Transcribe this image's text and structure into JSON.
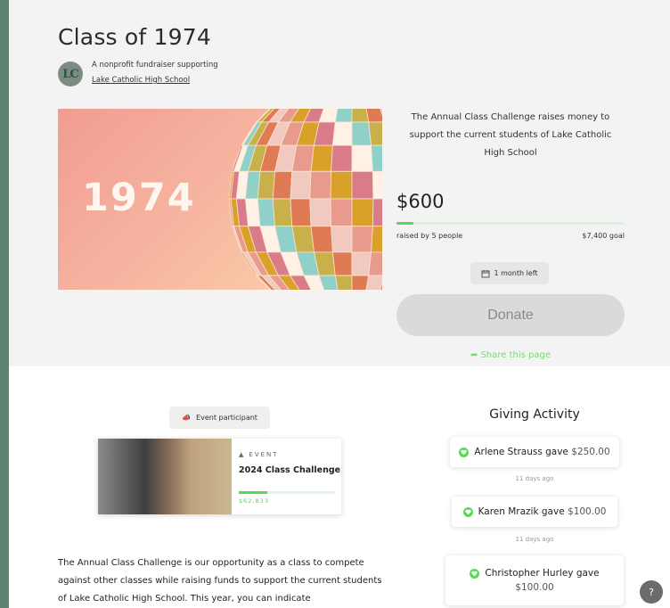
{
  "page": {
    "title": "Class of 1974"
  },
  "org": {
    "logo_text": "LC",
    "line1": "A nonprofit fundraiser supporting",
    "link": "Lake Catholic High School"
  },
  "hero": {
    "year_text": "1974"
  },
  "campaign": {
    "description": "The Annual Class Challenge raises money to support the current students of Lake Catholic High School",
    "raised_amount": "$600",
    "progress_fraction": 0.075,
    "raised_by": "raised by 5 people",
    "goal": "$7,400 goal",
    "time_left": "1 month left",
    "donate_label": "Donate",
    "share_label": "Share this page"
  },
  "participant": {
    "badge_label": "Event participant"
  },
  "event_card": {
    "kind": "EVENT",
    "title": "2024 Class Challenge",
    "amount": "$62,833",
    "progress_fraction": 0.3
  },
  "body": {
    "text": "The Annual Class Challenge is our opportunity as a class to compete against other classes while raising funds to support the current students of Lake Catholic High School. This year, you can indicate"
  },
  "giving": {
    "title": "Giving Activity",
    "items": [
      {
        "name": "Arlene Strauss gave",
        "amount": "$250.00",
        "ago": "11 days ago"
      },
      {
        "name": "Karen Mrazik gave",
        "amount": "$100.00",
        "ago": "11 days ago"
      },
      {
        "name": "Christopher Hurley gave",
        "amount": "$100.00",
        "ago": ""
      }
    ]
  },
  "help": {
    "label": "?"
  },
  "colors": {
    "accent": "#57d957",
    "background": "#5f8372"
  }
}
